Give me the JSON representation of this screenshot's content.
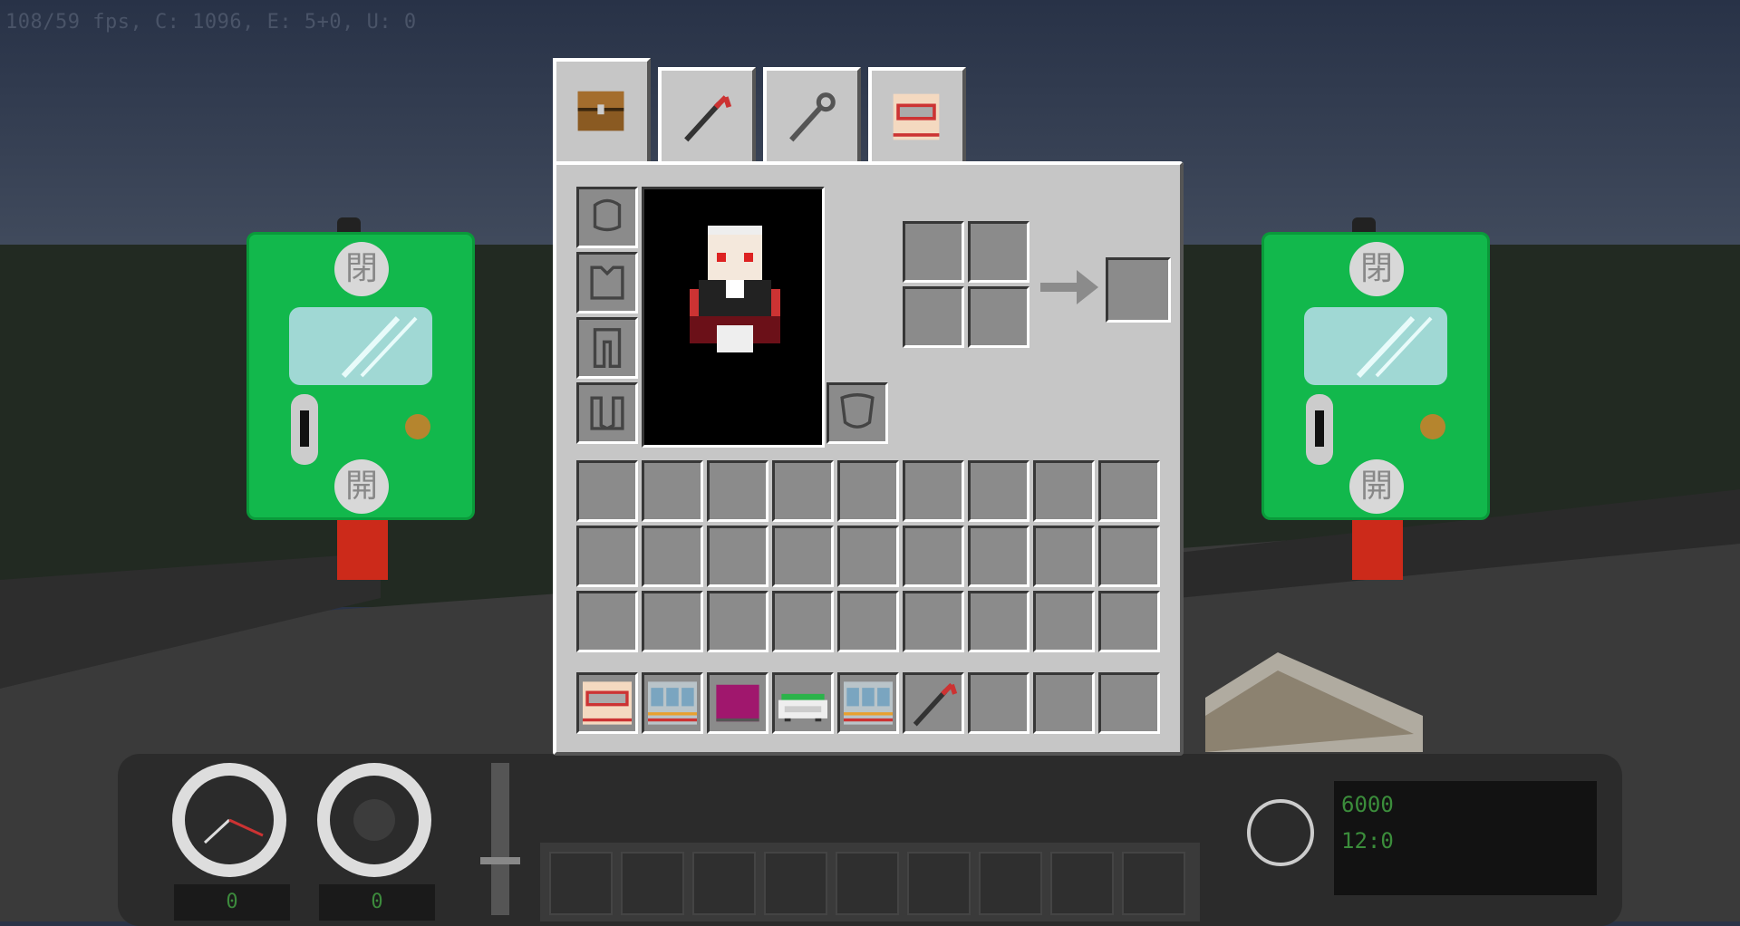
{
  "debug_overlay": {
    "text": "108/59 fps, C: 1096, E: 5+0, U: 0"
  },
  "tabs": [
    {
      "name": "chest-tab",
      "icon": "chest-icon",
      "active": true
    },
    {
      "name": "crowbar-tab",
      "icon": "crowbar-icon",
      "active": false
    },
    {
      "name": "wrench-tab",
      "icon": "wrench-icon",
      "active": false
    },
    {
      "name": "train-tab",
      "icon": "train-car-icon",
      "active": false
    }
  ],
  "armor_slots": [
    "helmet-slot-icon",
    "chestplate-slot-icon",
    "leggings-slot-icon",
    "boots-slot-icon"
  ],
  "offhand_slot": {
    "icon": "shield-slot-icon"
  },
  "crafting": {
    "grid_size": "2x2",
    "result": "empty"
  },
  "inventory_rows": 3,
  "inventory_cols": 9,
  "hotbar_items": [
    {
      "icon": "red-train-car-icon"
    },
    {
      "icon": "commuter-train-icon"
    },
    {
      "icon": "magenta-block-icon"
    },
    {
      "icon": "green-white-train-icon"
    },
    {
      "icon": "commuter-train-icon"
    },
    {
      "icon": "crowbar-icon"
    },
    {
      "icon": "empty"
    },
    {
      "icon": "empty"
    },
    {
      "icon": "empty"
    }
  ],
  "dashboard": {
    "speed_readout": "0",
    "pressure_readout": "0",
    "destination_lines": [
      "6000",
      "12:0"
    ]
  },
  "door_signs": [
    {
      "top_label": "閉",
      "bottom_label": "開"
    },
    {
      "top_label": "閉",
      "bottom_label": "開"
    }
  ],
  "colors": {
    "panel": "#c6c6c6",
    "slot": "#8b8b8b",
    "sign_green": "#12b84c",
    "readout_green": "#3b8d3b"
  }
}
